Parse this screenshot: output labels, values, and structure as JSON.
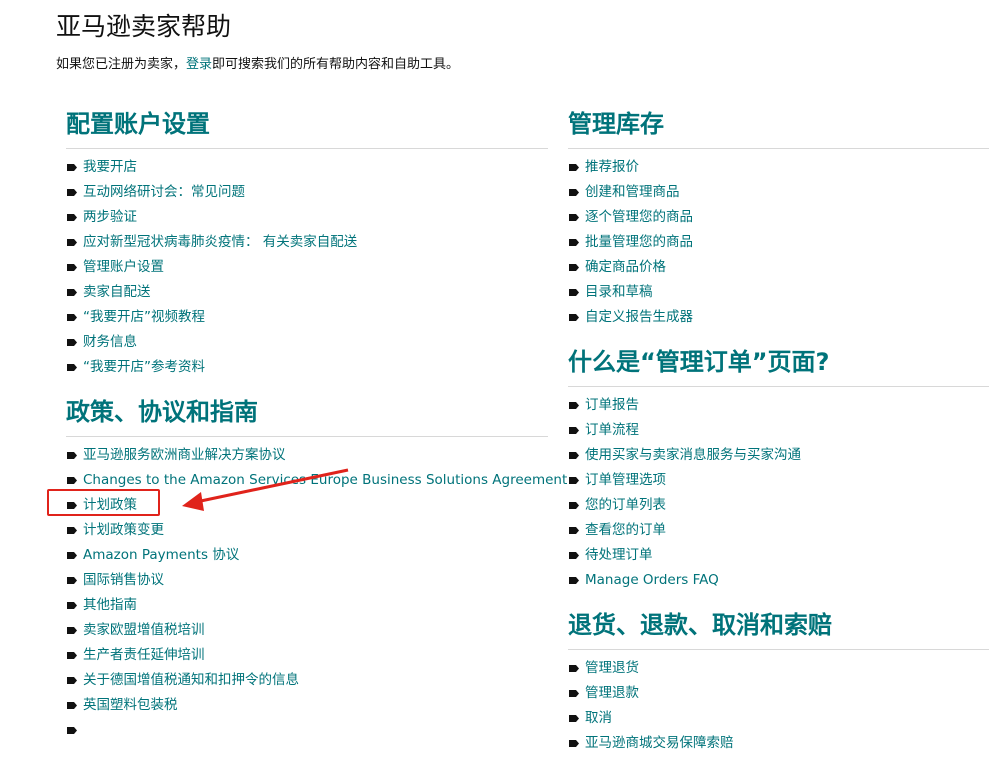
{
  "header": {
    "title": "亚马逊卖家帮助",
    "intro_prefix": "如果您已注册为卖家，",
    "intro_link": "登录",
    "intro_suffix": "即可搜索我们的所有帮助内容和自助工具。"
  },
  "left": {
    "sections": [
      {
        "title": "配置账户设置",
        "items": [
          "我要开店",
          "互动网络研讨会：常见问题",
          "两步验证",
          "应对新型冠状病毒肺炎疫情： 有关卖家自配送",
          "管理账户设置",
          "卖家自配送",
          "“我要开店”视频教程",
          "财务信息",
          "“我要开店”参考资料"
        ]
      },
      {
        "title": "政策、协议和指南",
        "items": [
          "亚马逊服务欧洲商业解决方案协议",
          "Changes to the Amazon Services Europe Business Solutions Agreement",
          "计划政策",
          "计划政策变更",
          "Amazon Payments 协议",
          "国际销售协议",
          "其他指南",
          "卖家欧盟增值税培训",
          "生产者责任延伸培训",
          "关于德国增值税通知和扣押令的信息",
          "英国塑料包装税",
          ""
        ]
      }
    ]
  },
  "right": {
    "sections": [
      {
        "title": "管理库存",
        "items": [
          "推荐报价",
          "创建和管理商品",
          "逐个管理您的商品",
          "批量管理您的商品",
          "确定商品价格",
          "目录和草稿",
          "自定义报告生成器"
        ]
      },
      {
        "title": "什么是“管理订单”页面?",
        "items": [
          "订单报告",
          "订单流程",
          "使用买家与卖家消息服务与买家沟通",
          "订单管理选项",
          "您的订单列表",
          "查看您的订单",
          "待处理订单",
          "Manage Orders FAQ"
        ]
      },
      {
        "title": "退货、退款、取消和索赔",
        "items": [
          "管理退货",
          "管理退款",
          "取消",
          "亚马逊商城交易保障索赔"
        ]
      }
    ]
  },
  "colors": {
    "accent": "#00737a",
    "annotation": "#e0231b"
  }
}
